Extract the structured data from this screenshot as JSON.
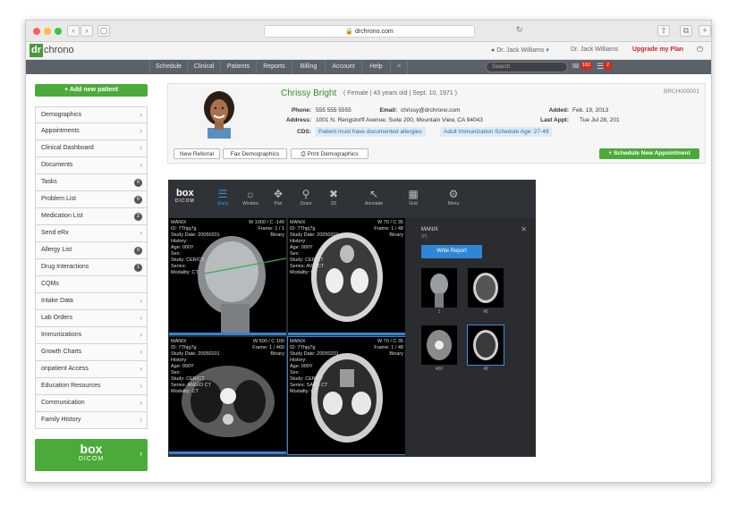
{
  "browser": {
    "url": "drchrono.com",
    "lock_icon": "lock-icon",
    "colors": {
      "red": "#fc605b",
      "yellow": "#fdbc40",
      "green": "#34c84a"
    }
  },
  "app": {
    "logo_dr": "dr",
    "logo_chrono": "chrono",
    "user_top": "Dr. Jack Williams",
    "user_second": "Dr. Jack Williams",
    "upgrade": "Upgrade my Plan",
    "accent": "#4caa3a"
  },
  "nav": {
    "items": [
      "Schedule",
      "Clinical",
      "Patients",
      "Reports",
      "Billing",
      "Account",
      "Help"
    ],
    "search_placeholder": "Search",
    "mail_count": "162",
    "task_count": "2"
  },
  "sidebar": {
    "add_patient": "+ Add new patient",
    "items": [
      {
        "label": "Demographics",
        "count": null
      },
      {
        "label": "Appointments",
        "count": null
      },
      {
        "label": "Clinical Dashboard",
        "count": null
      },
      {
        "label": "Documents",
        "count": null
      },
      {
        "label": "Tasks",
        "count": "0"
      },
      {
        "label": "Problem List",
        "count": "0"
      },
      {
        "label": "Medication List",
        "count": "2"
      },
      {
        "label": "Send eRx",
        "count": null
      },
      {
        "label": "Allergy List",
        "count": "0"
      },
      {
        "label": "Drug Interactions",
        "count": "1"
      },
      {
        "label": "CQMs",
        "count": null
      },
      {
        "label": "Intake Data",
        "count": null
      },
      {
        "label": "Lab Orders",
        "count": null
      },
      {
        "label": "Immunizations",
        "count": null
      },
      {
        "label": "Growth Charts",
        "count": null
      },
      {
        "label": "onpatient Access",
        "count": null
      },
      {
        "label": "Education Resources",
        "count": null
      },
      {
        "label": "Communication",
        "count": null
      },
      {
        "label": "Family History",
        "count": null
      }
    ],
    "promo_line1": "box",
    "promo_line2": "DICOM"
  },
  "patient": {
    "name": "Chrissy Bright",
    "meta": "( Female | 43 years old | Sept. 10, 1971 )",
    "id": "BRCH000001",
    "phone_label": "Phone:",
    "phone": "555 555 5555",
    "email_label": "Email:",
    "email": "chrissy@drchrono.com",
    "added_label": "Added:",
    "added": "Feb. 19, 2013",
    "address_label": "Address:",
    "address": "1001 N. Rengstorff Avenue, Suite 200, Mountain View, CA 94043",
    "last_appt_label": "Last Appt:",
    "last_appt": "Tue Jul 28, 201",
    "cds_label": "CDS:",
    "cds": [
      "Patient must have documented allergies",
      "Adult Immunization Schedule Age: 27-49"
    ],
    "buttons": {
      "new_referral": "New Referral",
      "fax": "Fax Demographics",
      "print": "Print Demographics",
      "schedule": "+ Schedule New Appointment"
    }
  },
  "viewer": {
    "logo_top": "box",
    "logo_bottom": "DICOM",
    "tools": [
      "Stack",
      "Window",
      "Pan",
      "Zoom",
      "3D",
      "Annotate",
      "Grid",
      "Menu"
    ],
    "panes": [
      {
        "name": "MANIX",
        "id": "ID: 7Thjq7g",
        "date": "Study Date: 20050201",
        "history": "History:",
        "age": "Age: 000Y",
        "sex": "Sex:",
        "study": "Study: CER/CT",
        "series": "Series:",
        "modality": "Modality: CT",
        "wc": "W 1000 / C -140",
        "frame": "Frame: 1 / 1",
        "binary": "Binary"
      },
      {
        "name": "MANIX",
        "id": "ID: 7Thjq7g",
        "date": "Study Date: 20050201",
        "history": "History:",
        "age": "Age: 000Y",
        "sex": "Sex:",
        "study": "Study: CER/CT",
        "series": "Series: AVG CT",
        "modality": "Modality: CT",
        "wc": "W 70 / C 35",
        "frame": "Frame: 1 / 48",
        "binary": "Binary"
      },
      {
        "name": "MANIX",
        "id": "ID: 7Thjq7g",
        "date": "Study Date: 20050201",
        "history": "History:",
        "age": "Age: 000Y",
        "sex": "Sex:",
        "study": "Study: CER/CT",
        "series": "Series: ANGIO CT",
        "modality": "Modality: CT",
        "wc": "W 500 / C 100",
        "frame": "Frame: 1 / 460",
        "binary": "Binary"
      },
      {
        "name": "MANIX",
        "id": "ID: 7Thjq7g",
        "date": "Study Date: 20050201",
        "history": "History:",
        "age": "Age: 000Y",
        "sex": "Sex:",
        "study": "Study: CER/CT",
        "series": "Series: SANS CT",
        "modality": "Modality: CT",
        "wc": "W 70 / C 35",
        "frame": "Frame: 1 / 48",
        "binary": "Binary"
      }
    ],
    "side_title": "MANIX",
    "side_sub": "(P)",
    "write_report": "Write Report",
    "thumbs": [
      "1",
      "48",
      "460",
      "48"
    ]
  }
}
